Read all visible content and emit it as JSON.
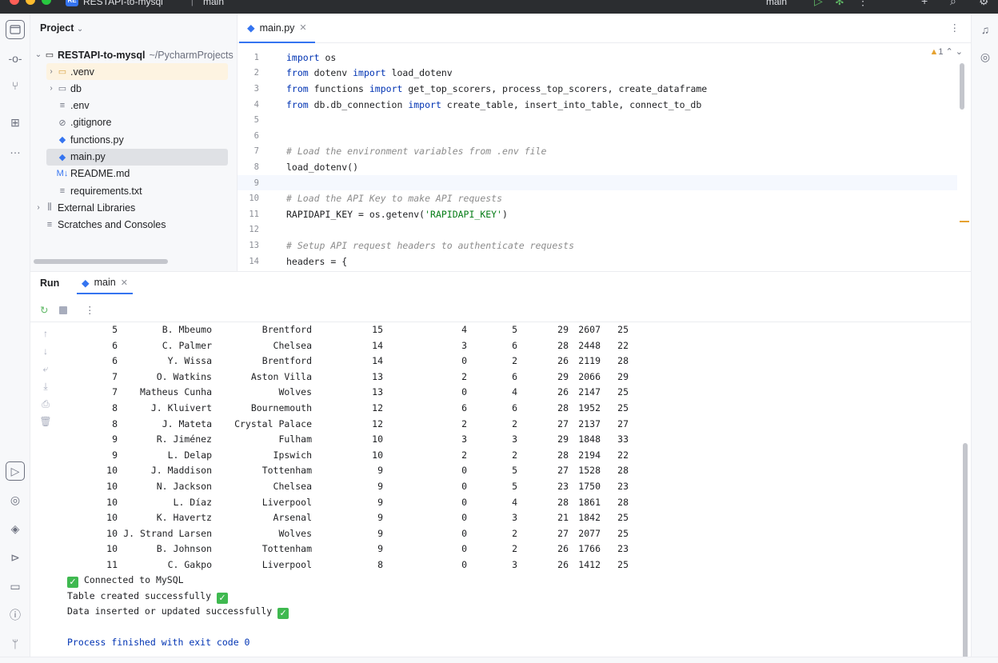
{
  "titlebar": {
    "project_badge": "RE",
    "project_name": "RESTAPI-to-mysql",
    "branch": "main",
    "run_config": "main"
  },
  "project_panel": {
    "title": "Project",
    "root": {
      "name": "RESTAPI-to-mysql",
      "path": "~/PycharmProjects"
    },
    "items": [
      {
        "label": ".venv",
        "icon": "folder-icon",
        "expandable": true,
        "selected": false,
        "highlighted": true
      },
      {
        "label": "db",
        "icon": "folder-icon",
        "expandable": true,
        "selected": false
      },
      {
        "label": ".env",
        "icon": "text-file-icon",
        "expandable": false,
        "selected": false
      },
      {
        "label": ".gitignore",
        "icon": "ignore-file-icon",
        "expandable": false,
        "selected": false
      },
      {
        "label": "functions.py",
        "icon": "python-file-icon",
        "expandable": false,
        "selected": false
      },
      {
        "label": "main.py",
        "icon": "python-file-icon",
        "expandable": false,
        "selected": true
      },
      {
        "label": "README.md",
        "icon": "markdown-file-icon",
        "expandable": false,
        "selected": false
      },
      {
        "label": "requirements.txt",
        "icon": "text-file-icon",
        "expandable": false,
        "selected": false
      },
      {
        "label": "External Libraries",
        "icon": "library-icon",
        "expandable": true,
        "selected": false
      },
      {
        "label": "Scratches and Consoles",
        "icon": "scratches-icon",
        "expandable": false,
        "selected": false
      }
    ]
  },
  "editor": {
    "tab_label": "main.py",
    "warning_count": "1",
    "current_line": 9,
    "lines": [
      {
        "n": "1",
        "tokens": [
          [
            "kw",
            "import"
          ],
          [
            "",
            " os"
          ]
        ]
      },
      {
        "n": "2",
        "tokens": [
          [
            "kw",
            "from"
          ],
          [
            "",
            " dotenv "
          ],
          [
            "kw",
            "import"
          ],
          [
            "",
            " load_dotenv"
          ]
        ]
      },
      {
        "n": "3",
        "tokens": [
          [
            "kw",
            "from"
          ],
          [
            "",
            " functions "
          ],
          [
            "kw",
            "import"
          ],
          [
            "",
            " get_top_scorers, process_top_scorers, create_dataframe"
          ]
        ]
      },
      {
        "n": "4",
        "tokens": [
          [
            "kw",
            "from"
          ],
          [
            "",
            " db.db_connection "
          ],
          [
            "kw",
            "import"
          ],
          [
            "",
            " create_table, insert_into_table, connect_to_db"
          ]
        ]
      },
      {
        "n": "5",
        "tokens": []
      },
      {
        "n": "6",
        "tokens": []
      },
      {
        "n": "7",
        "tokens": [
          [
            "cm",
            "# Load the environment variables from .env file"
          ]
        ]
      },
      {
        "n": "8",
        "tokens": [
          [
            "",
            "load_dotenv()"
          ]
        ]
      },
      {
        "n": "9",
        "tokens": []
      },
      {
        "n": "10",
        "tokens": [
          [
            "cm",
            "# Load the API Key to make API requests"
          ]
        ]
      },
      {
        "n": "11",
        "tokens": [
          [
            "",
            "RAPIDAPI_KEY = os.getenv("
          ],
          [
            "st",
            "'RAPIDAPI_KEY'"
          ],
          [
            "",
            ")"
          ]
        ]
      },
      {
        "n": "12",
        "tokens": []
      },
      {
        "n": "13",
        "tokens": [
          [
            "cm",
            "# Setup API request headers to authenticate requests"
          ]
        ]
      },
      {
        "n": "14",
        "tokens": [
          [
            "",
            "headers = {"
          ]
        ]
      }
    ]
  },
  "run_panel": {
    "title": "Run",
    "tab_label": "main",
    "rows": [
      [
        "5",
        "B. Mbeumo",
        "Brentford",
        "15",
        "4",
        "5",
        "29",
        "2607",
        "25"
      ],
      [
        "6",
        "C. Palmer",
        "Chelsea",
        "14",
        "3",
        "6",
        "28",
        "2448",
        "22"
      ],
      [
        "6",
        "Y. Wissa",
        "Brentford",
        "14",
        "0",
        "2",
        "26",
        "2119",
        "28"
      ],
      [
        "7",
        "O. Watkins",
        "Aston Villa",
        "13",
        "2",
        "6",
        "29",
        "2066",
        "29"
      ],
      [
        "7",
        "Matheus Cunha",
        "Wolves",
        "13",
        "0",
        "4",
        "26",
        "2147",
        "25"
      ],
      [
        "8",
        "J. Kluivert",
        "Bournemouth",
        "12",
        "6",
        "6",
        "28",
        "1952",
        "25"
      ],
      [
        "8",
        "J. Mateta",
        "Crystal Palace",
        "12",
        "2",
        "2",
        "27",
        "2137",
        "27"
      ],
      [
        "9",
        "R. Jiménez",
        "Fulham",
        "10",
        "3",
        "3",
        "29",
        "1848",
        "33"
      ],
      [
        "9",
        "L. Delap",
        "Ipswich",
        "10",
        "2",
        "2",
        "28",
        "2194",
        "22"
      ],
      [
        "10",
        "J. Maddison",
        "Tottenham",
        "9",
        "0",
        "5",
        "27",
        "1528",
        "28"
      ],
      [
        "10",
        "N. Jackson",
        "Chelsea",
        "9",
        "0",
        "5",
        "23",
        "1750",
        "23"
      ],
      [
        "10",
        "L. Díaz",
        "Liverpool",
        "9",
        "0",
        "4",
        "28",
        "1861",
        "28"
      ],
      [
        "10",
        "K. Havertz",
        "Arsenal",
        "9",
        "0",
        "3",
        "21",
        "1842",
        "25"
      ],
      [
        "10",
        "J. Strand Larsen",
        "Wolves",
        "9",
        "0",
        "2",
        "27",
        "2077",
        "25"
      ],
      [
        "10",
        "B. Johnson",
        "Tottenham",
        "9",
        "0",
        "2",
        "26",
        "1766",
        "23"
      ],
      [
        "11",
        "C. Gakpo",
        "Liverpool",
        "8",
        "0",
        "3",
        "26",
        "1412",
        "25"
      ]
    ],
    "messages": {
      "connected": "Connected to MySQL",
      "table_created": "Table created successfully",
      "data_inserted": "Data inserted or updated successfully",
      "exit": "Process finished with exit code 0"
    }
  },
  "colors": {
    "accent": "#3574f0",
    "keyword": "#0033b3",
    "comment": "#8c8c8c",
    "string": "#067d17",
    "check": "#3fb950"
  }
}
